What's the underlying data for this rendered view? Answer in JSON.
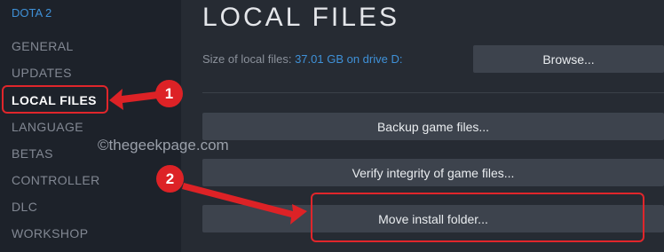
{
  "sidebar": {
    "game_title": "DOTA 2",
    "items": [
      {
        "label": "GENERAL"
      },
      {
        "label": "UPDATES"
      },
      {
        "label": "LOCAL FILES"
      },
      {
        "label": "LANGUAGE"
      },
      {
        "label": "BETAS"
      },
      {
        "label": "CONTROLLER"
      },
      {
        "label": "DLC"
      },
      {
        "label": "WORKSHOP"
      }
    ]
  },
  "main": {
    "title": "LOCAL FILES",
    "size_label": "Size of local files:",
    "size_value": "37.01 GB on drive D:",
    "browse_label": "Browse...",
    "buttons": {
      "backup": "Backup game files...",
      "verify": "Verify integrity of game files...",
      "move": "Move install folder..."
    }
  },
  "annotations": {
    "badge1": "1",
    "badge2": "2",
    "watermark": "©thegeekpage.com",
    "accent_color": "#e0262b"
  },
  "colors": {
    "link_blue": "#3f91d8",
    "sidebar_bg": "#1d222a",
    "main_bg": "#262b33",
    "button_bg": "#3d434d"
  }
}
